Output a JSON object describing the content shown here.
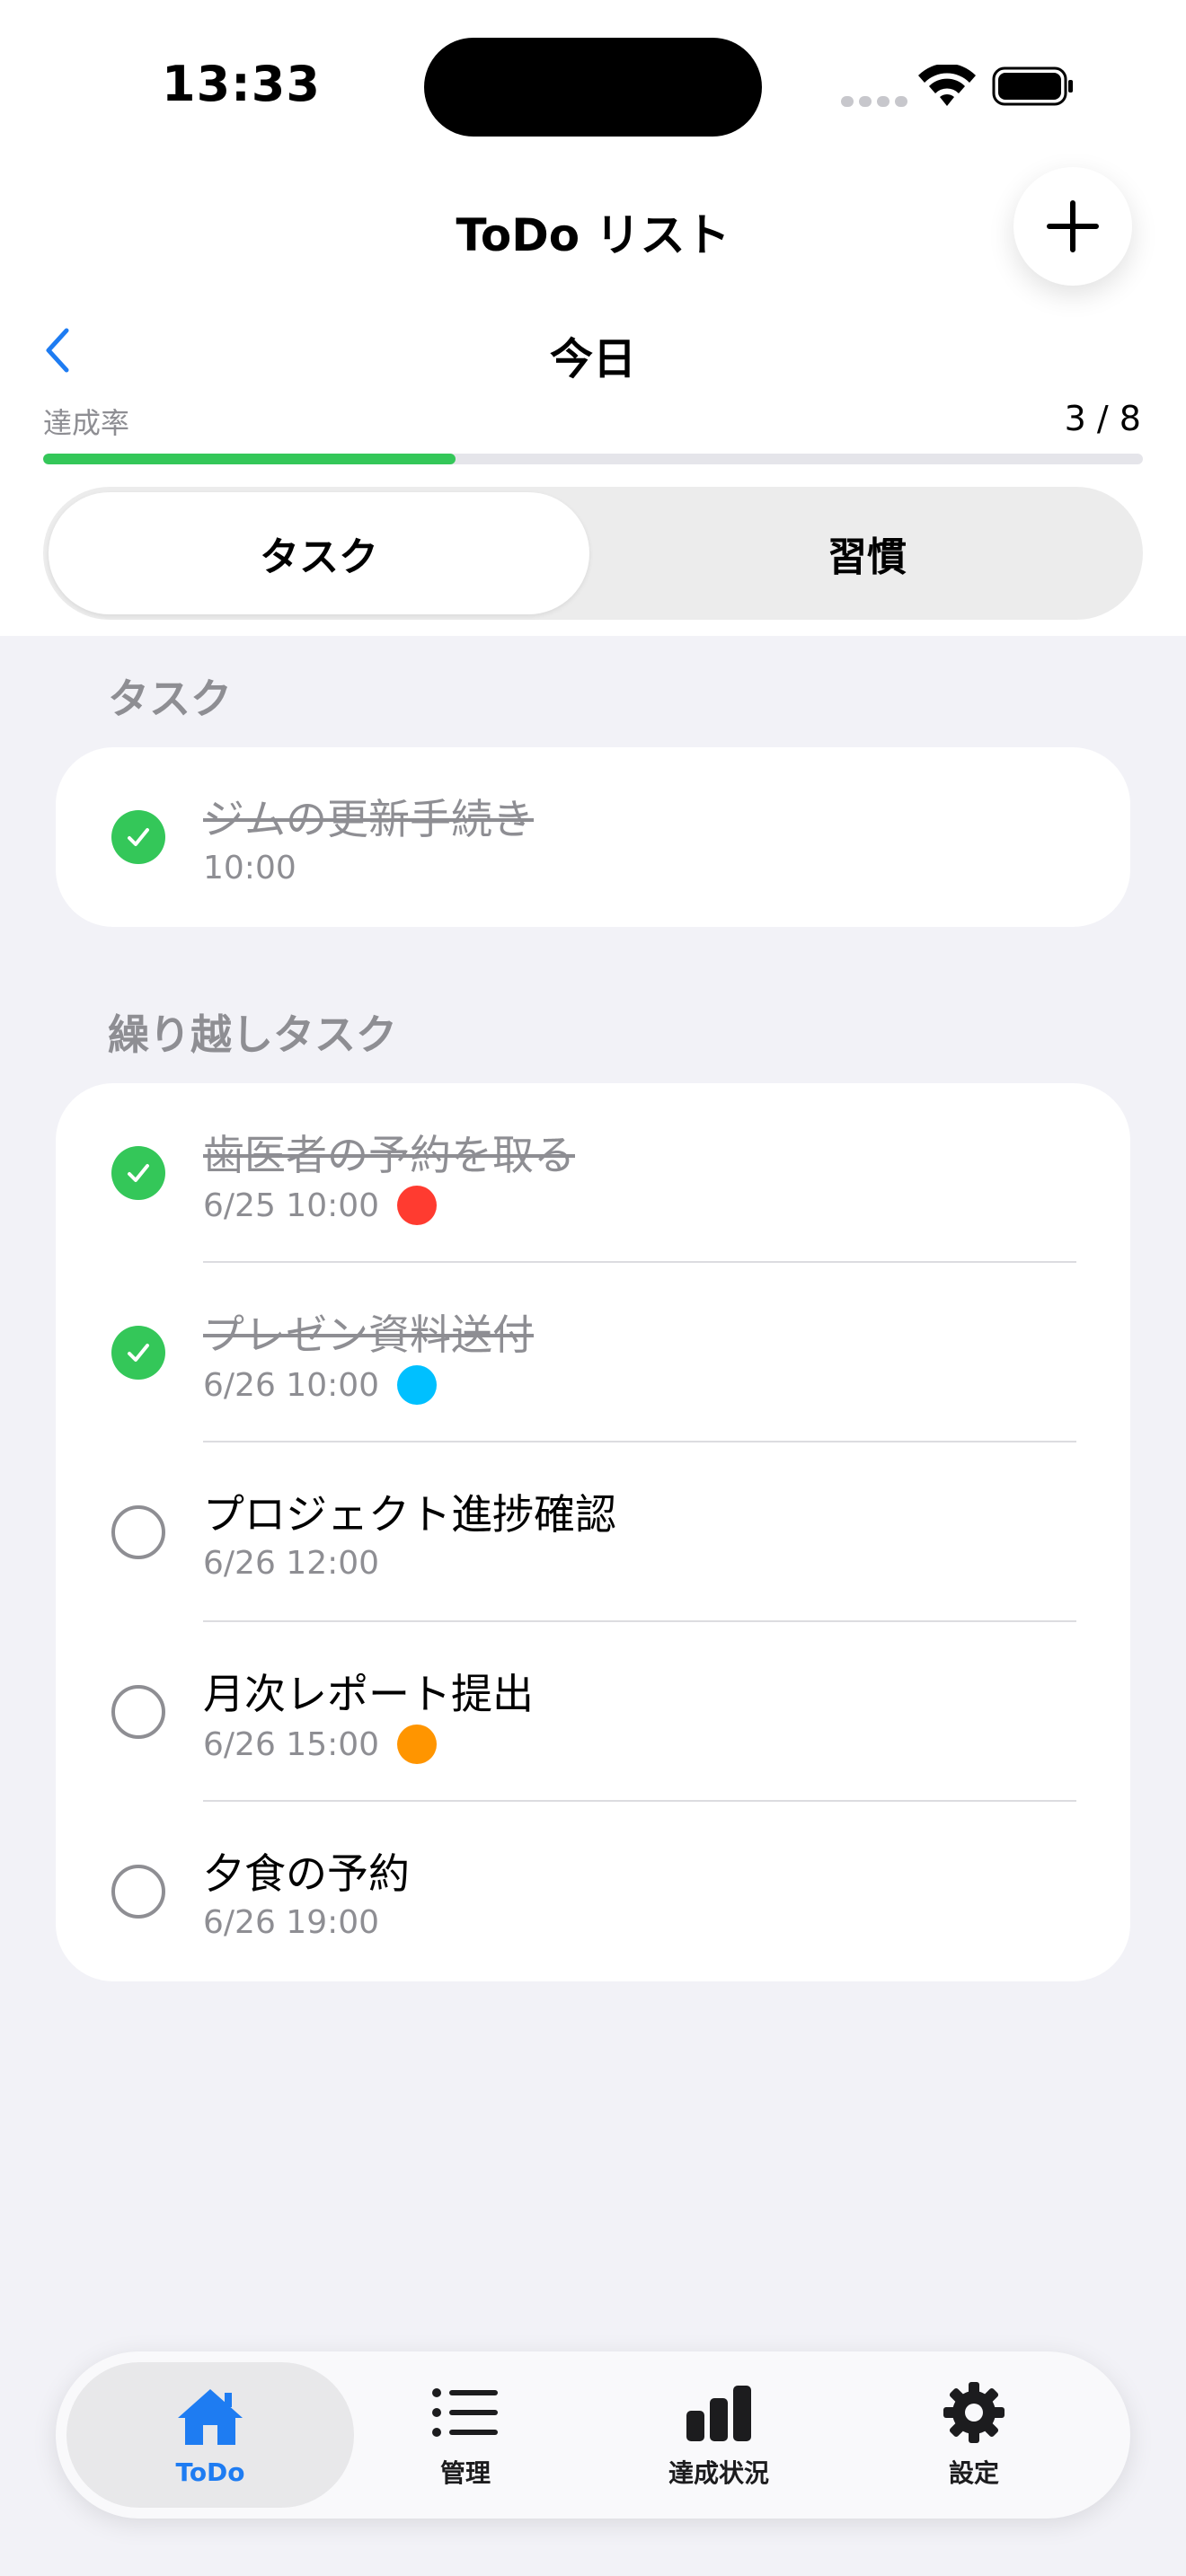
{
  "status_bar": {
    "time": "13:33"
  },
  "nav": {
    "title": "ToDo リスト"
  },
  "date_header": {
    "title": "今日"
  },
  "progress": {
    "label": "達成率",
    "count_text": "3 / 8",
    "fraction": 0.375
  },
  "segment": {
    "items": [
      {
        "label": "タスク"
      },
      {
        "label": "習慣"
      }
    ],
    "selected": 0
  },
  "sections": {
    "today": {
      "header": "タスク",
      "tasks": [
        {
          "title": "ジムの更新手続き",
          "time": "10:00",
          "done": true
        }
      ]
    },
    "carryover": {
      "header": "繰り越しタスク",
      "tasks": [
        {
          "title": "歯医者の予約を取る",
          "time": "6/25 10:00",
          "done": true,
          "color": "#ff3b30"
        },
        {
          "title": "プレゼン資料送付",
          "time": "6/26 10:00",
          "done": true,
          "color": "#00c0ff"
        },
        {
          "title": "プロジェクト進捗確認",
          "time": "6/26 12:00",
          "done": false
        },
        {
          "title": "月次レポート提出",
          "time": "6/26 15:00",
          "done": false,
          "color": "#ff9500"
        },
        {
          "title": "夕食の予約",
          "time": "6/26 19:00",
          "done": false
        }
      ]
    }
  },
  "tabbar": {
    "items": [
      {
        "label": "ToDo",
        "icon": "house-icon"
      },
      {
        "label": "管理",
        "icon": "list-icon"
      },
      {
        "label": "達成状況",
        "icon": "chart-icon"
      },
      {
        "label": "設定",
        "icon": "gear-icon"
      }
    ]
  },
  "colors": {
    "accent": "#1e7cf2",
    "done": "#34c759"
  }
}
